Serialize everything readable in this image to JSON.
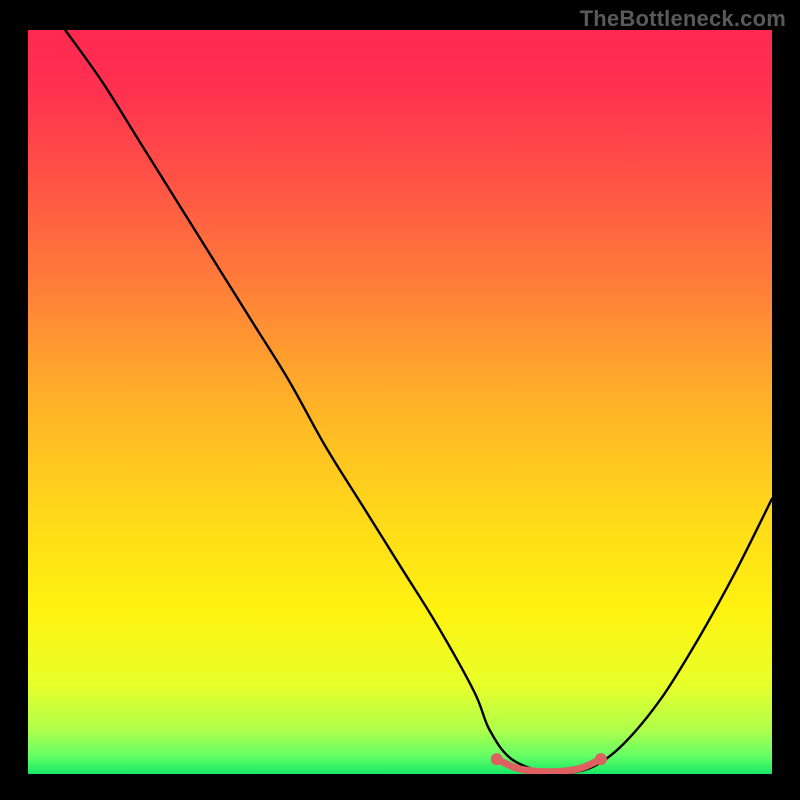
{
  "watermark": "TheBottleneck.com",
  "chart_data": {
    "type": "line",
    "title": "",
    "xlabel": "",
    "ylabel": "",
    "xlim": [
      0,
      100
    ],
    "ylim": [
      0,
      100
    ],
    "grid": false,
    "legend": false,
    "background_gradient": {
      "stops": [
        {
          "offset": 0.0,
          "color": "#ff2850"
        },
        {
          "offset": 0.08,
          "color": "#ff3150"
        },
        {
          "offset": 0.2,
          "color": "#ff5245"
        },
        {
          "offset": 0.35,
          "color": "#ff8038"
        },
        {
          "offset": 0.5,
          "color": "#ffb228"
        },
        {
          "offset": 0.65,
          "color": "#ffd81a"
        },
        {
          "offset": 0.78,
          "color": "#fff310"
        },
        {
          "offset": 0.88,
          "color": "#e8ff2a"
        },
        {
          "offset": 0.94,
          "color": "#b0ff4a"
        },
        {
          "offset": 0.975,
          "color": "#66ff66"
        },
        {
          "offset": 1.0,
          "color": "#17e866"
        }
      ]
    },
    "series": [
      {
        "name": "bottleneck-curve",
        "color": "#000000",
        "x": [
          5,
          10,
          15,
          20,
          25,
          30,
          35,
          40,
          45,
          50,
          55,
          60,
          62,
          65,
          70,
          72,
          76,
          80,
          85,
          90,
          95,
          100
        ],
        "y": [
          100,
          93,
          85,
          77,
          69,
          61,
          53,
          44,
          36,
          28,
          20,
          11,
          6,
          2,
          0,
          0,
          1,
          4,
          10,
          18,
          27,
          37
        ]
      }
    ],
    "markers": [
      {
        "name": "flat-bottom-left",
        "shape": "circle",
        "color": "#de6060",
        "x": 63,
        "y": 2,
        "size": 6
      },
      {
        "name": "flat-bottom-right",
        "shape": "circle",
        "color": "#de6060",
        "x": 77,
        "y": 2,
        "size": 6
      }
    ],
    "highlight_segment": {
      "name": "optimal-range",
      "color": "#de6060",
      "width": 7,
      "x": [
        63,
        66,
        70,
        74,
        77
      ],
      "y": [
        2,
        0.7,
        0.3,
        0.7,
        2
      ]
    }
  }
}
